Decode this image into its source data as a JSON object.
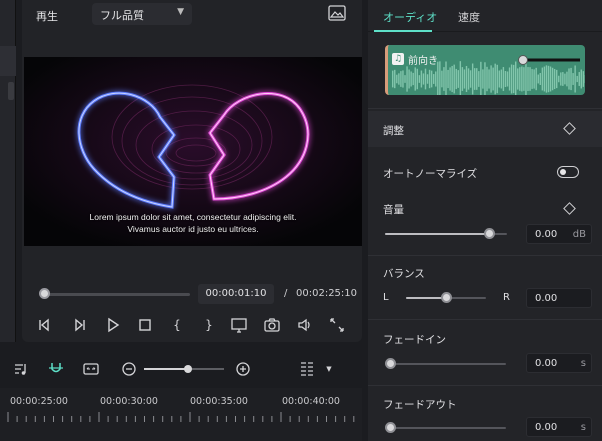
{
  "player": {
    "play_label": "再生",
    "quality": "フル品質",
    "subtitle_line1": "Lorem ipsum dolor sit amet, consectetur adipiscing elit.",
    "subtitle_line2": "Vivamus auctor id justo eu ultrices.",
    "current_time": "00:00:01:10",
    "time_separator": "/",
    "total_time": "00:02:25:10",
    "playhead_progress": 0.01
  },
  "timeline": {
    "labels": [
      "00:00:25:00",
      "00:00:30:00",
      "00:00:35:00",
      "00:00:40:00"
    ],
    "zoom_level": 0.55
  },
  "audio_panel": {
    "tabs": [
      {
        "label": "オーディオ",
        "active": true
      },
      {
        "label": "速度",
        "active": false
      }
    ],
    "clip_title": "前向き",
    "adjust_section": "調整",
    "auto_normalize": {
      "label": "オートノーマライズ",
      "enabled": false
    },
    "volume": {
      "label": "音量",
      "value": "0.00",
      "unit": "dB",
      "level": 0.85
    },
    "balance": {
      "label": "バランス",
      "left": "L",
      "right": "R",
      "value": "0.00",
      "level": 0.5
    },
    "fade_in": {
      "label": "フェードイン",
      "value": "0.00",
      "unit": "s",
      "level": 0
    },
    "fade_out": {
      "label": "フェードアウト",
      "value": "0.00",
      "unit": "s",
      "level": 0
    }
  },
  "colors": {
    "accent": "#5ee0c8",
    "clip": "#3f8c72",
    "neon_blue": "#3b6bff",
    "neon_pink": "#e04bd8"
  }
}
